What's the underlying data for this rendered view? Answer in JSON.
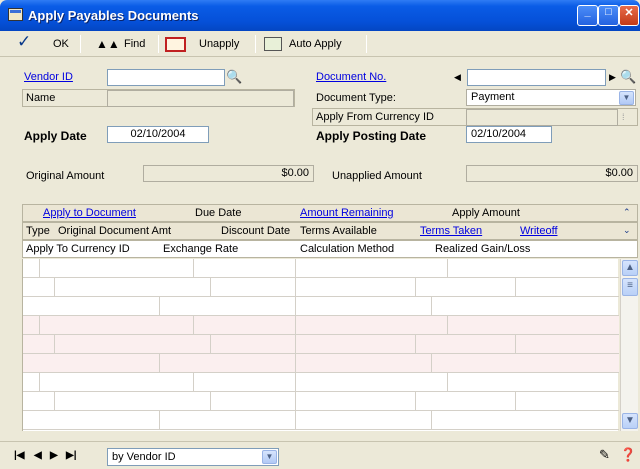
{
  "window": {
    "title": "Apply Payables Documents"
  },
  "toolbar": {
    "ok": "OK",
    "find": "Find",
    "unapply": "Unapply",
    "auto_apply": "Auto Apply"
  },
  "form": {
    "vendor_id_label": "Vendor ID",
    "vendor_id_value": "",
    "name_label": "Name",
    "name_value": "",
    "apply_date_label": "Apply Date",
    "apply_date_value": "02/10/2004",
    "document_no_label": "Document No.",
    "document_no_value": "",
    "document_type_label": "Document Type:",
    "document_type_value": "Payment",
    "apply_from_currency_label": "Apply From Currency ID",
    "apply_from_currency_value": "",
    "apply_posting_date_label": "Apply Posting Date",
    "apply_posting_date_value": "02/10/2004",
    "original_amount_label": "Original Amount",
    "original_amount_value": "$0.00",
    "unapplied_amount_label": "Unapplied Amount",
    "unapplied_amount_value": "$0.00"
  },
  "grid": {
    "header1": [
      "Apply to Document",
      "Due Date",
      "Amount Remaining",
      "Apply Amount"
    ],
    "header2": [
      "Type",
      "Original Document Amt",
      "Discount Date",
      "Terms Available",
      "Terms Taken",
      "Writeoff"
    ],
    "header3": [
      "Apply To Currency ID",
      "Exchange Rate",
      "Calculation Method",
      "Realized Gain/Loss"
    ]
  },
  "bottom": {
    "sort_value": "by Vendor ID"
  },
  "icons": [
    "checkmark-icon",
    "binoculars-icon",
    "unapply-icon",
    "auto-apply-icon",
    "lookup-icon",
    "note-icon",
    "help-icon"
  ]
}
